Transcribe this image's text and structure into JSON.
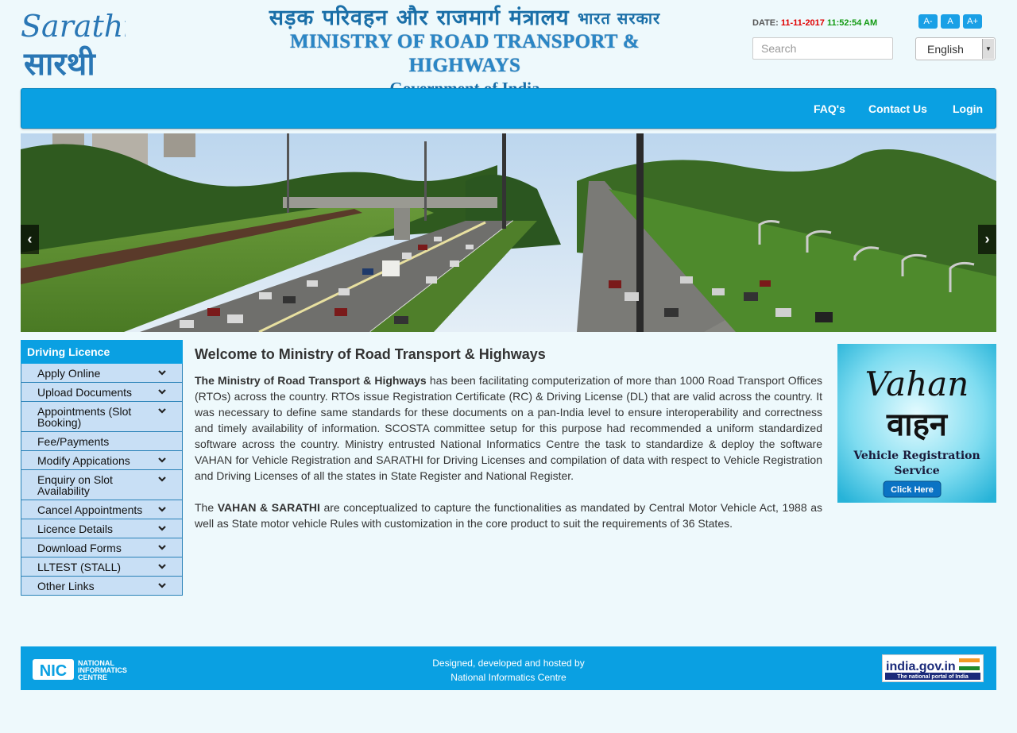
{
  "header": {
    "logo_text_en": "Sarathi",
    "logo_text_hi": "सारथी",
    "ministry_hindi": "सड़क परिवहन और राजमार्ग मंत्रालय",
    "ministry_hindi_sub": "भारत सरकार",
    "ministry_english": "MINISTRY OF ROAD TRANSPORT & HIGHWAYS",
    "government": "Government of India",
    "date_label": "DATE:",
    "date_value": "11-11-2017",
    "time_value": "11:52:54 AM",
    "font_small": "A-",
    "font_normal": "A",
    "font_large": "A+",
    "search_placeholder": "Search",
    "language_selected": "English"
  },
  "nav": {
    "faq": "FAQ's",
    "contact": "Contact Us",
    "login": "Login"
  },
  "carousel": {
    "prev": "‹",
    "next": "›"
  },
  "sidebar": {
    "heading": "Driving Licence",
    "items": [
      {
        "label": "Apply Online",
        "expandable": true
      },
      {
        "label": "Upload Documents",
        "expandable": true
      },
      {
        "label": "Appointments (Slot Booking)",
        "expandable": true
      },
      {
        "label": "Fee/Payments",
        "expandable": false
      },
      {
        "label": "Modify Appications",
        "expandable": true
      },
      {
        "label": "Enquiry on Slot Availability",
        "expandable": true
      },
      {
        "label": "Cancel Appointments",
        "expandable": true
      },
      {
        "label": "Licence Details",
        "expandable": true
      },
      {
        "label": "Download Forms",
        "expandable": true
      },
      {
        "label": "LLTEST (STALL)",
        "expandable": true
      },
      {
        "label": "Other Links",
        "expandable": true
      }
    ]
  },
  "main": {
    "title": "Welcome to Ministry of Road Transport & Highways",
    "p1_bold": "The Ministry of Road Transport & Highways",
    "p1_rest": " has been facilitating computerization of more than 1000 Road Transport Offices (RTOs) across the country. RTOs issue Registration Certificate (RC) & Driving License (DL) that are valid across the country. It was necessary to define same standards for these documents on a pan-India level to ensure interoperability and correctness and timely availability of information. SCOSTA committee setup for this purpose had recommended a uniform standardized software across the country. Ministry entrusted National Informatics Centre the task to standardize & deploy the software VAHAN for Vehicle Registration and SARATHI for Driving Licenses and compilation of data with respect to Vehicle Registration and Driving Licenses of all the states in State Register and National Register.",
    "p2_start": "The ",
    "p2_bold": "VAHAN & SARATHI",
    "p2_rest": " are conceptualized to capture the functionalities as mandated by Central Motor Vehicle Act, 1988 as well as State motor vehicle Rules with customization in the core product to suit the requirements of 36 States."
  },
  "vahan_ad": {
    "title_en": "Vahan",
    "title_hi": "वाहन",
    "subtitle_line1": "Vehicle Registration",
    "subtitle_line2": "Service",
    "button": "Click Here"
  },
  "footer": {
    "line1": "Designed, developed and hosted by",
    "line2": "National Informatics Centre",
    "nic_line1": "NATIONAL",
    "nic_line2": "INFORMATICS",
    "nic_line3": "CENTRE",
    "india_gov": "india.gov.in",
    "india_gov_sub": "The national portal of India"
  },
  "colors": {
    "primary_blue": "#0aa0e2",
    "page_bg": "#eef9fc",
    "sidebar_item_bg": "#c8dff5",
    "date_red": "#e00000",
    "time_green": "#119a11"
  }
}
